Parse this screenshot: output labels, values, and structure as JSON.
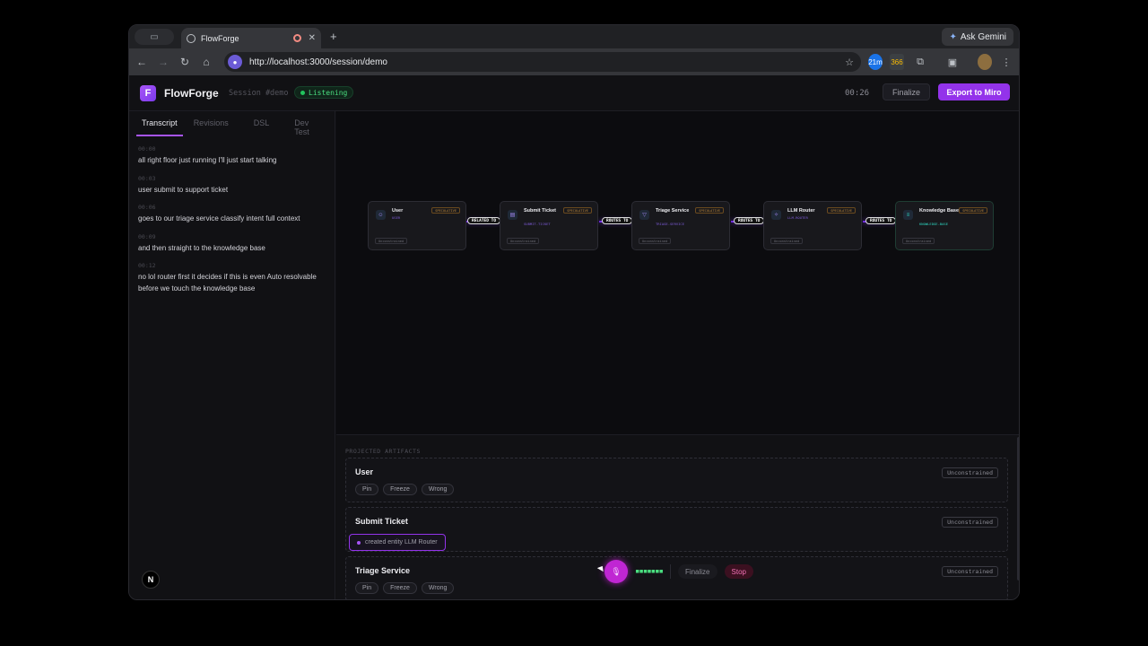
{
  "browser": {
    "tab_title": "FlowForge",
    "url": "http://localhost:3000/session/demo",
    "gemini_label": "Ask Gemini",
    "ext_badge_1": "21m",
    "ext_badge_2": "366"
  },
  "header": {
    "logo_letter": "F",
    "brand": "FlowForge",
    "session": "Session #demo",
    "status": "Listening",
    "timer": "00:26",
    "finalize_label": "Finalize",
    "export_label": "Export to Miro"
  },
  "sidebar": {
    "tabs": [
      "Transcript",
      "Revisions",
      "DSL",
      "Dev Test"
    ],
    "entries": [
      {
        "ts": "00:00",
        "text": "all right floor just running I'll just start talking"
      },
      {
        "ts": "00:03",
        "text": "user submit to support ticket"
      },
      {
        "ts": "00:06",
        "text": "goes to our triage service classify intent full context"
      },
      {
        "ts": "00:09",
        "text": "and then straight to the knowledge base"
      },
      {
        "ts": "00:12",
        "text": "no lol router first it decides if this is even Auto resolvable before we touch the knowledge base"
      }
    ],
    "badge": "N"
  },
  "graph": {
    "nodes": [
      {
        "name": "User",
        "sub": "USER",
        "tag": "SPECULATIVE",
        "status": "Unconstrained"
      },
      {
        "name": "Submit Ticket",
        "sub": "SUBMIT-TICKET",
        "tag": "SPECULATIVE",
        "status": "Unconstrained"
      },
      {
        "name": "Triage Service",
        "sub": "TRIAGE-SERVICE",
        "tag": "SPECULATIVE",
        "status": "Unconstrained"
      },
      {
        "name": "LLM Router",
        "sub": "LLM-ROUTER",
        "tag": "SPECULATIVE",
        "status": "Unconstrained"
      },
      {
        "name": "Knowledge Base",
        "sub": "KNOWLEDGE-BASE",
        "tag": "SPECULATIVE",
        "status": "Unconstrained"
      }
    ],
    "edges": [
      "RELATED TO",
      "ROUTES TO",
      "ROUTES TO",
      "ROUTES TO"
    ]
  },
  "artifacts": {
    "title": "PROJECTED ARTIFACTS",
    "cards": [
      {
        "name": "User",
        "status": "Unconstrained",
        "actions": [
          "Pin",
          "Freeze",
          "Wrong"
        ]
      },
      {
        "name": "Submit Ticket",
        "status": "Unconstrained",
        "toast": "created entity LLM Router"
      },
      {
        "name": "Triage Service",
        "status": "Unconstrained",
        "actions": [
          "Pin",
          "Freeze",
          "Wrong"
        ]
      }
    ]
  },
  "voice": {
    "finalize_label": "Finalize",
    "stop_label": "Stop"
  }
}
